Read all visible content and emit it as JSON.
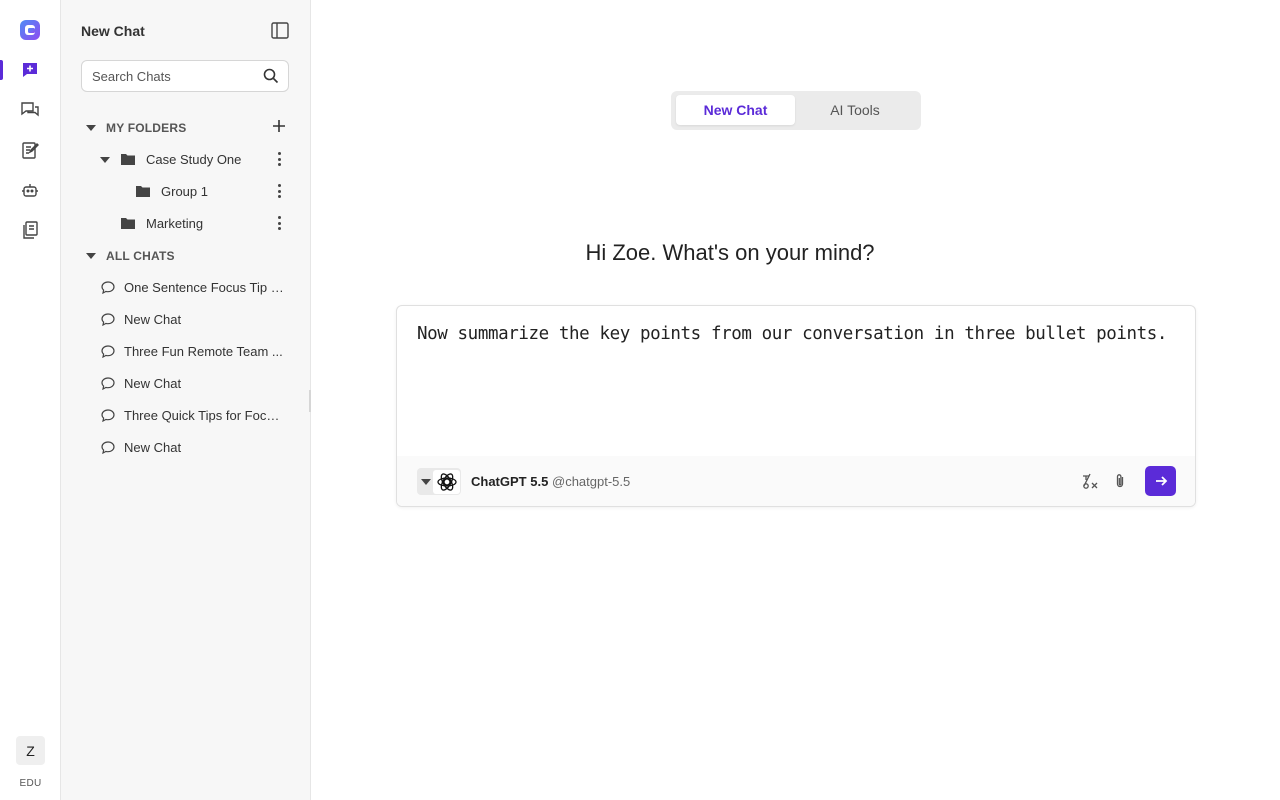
{
  "rail": {
    "avatar_initial": "Z",
    "edu_label": "EDU",
    "accent_color": "#5b2bd8"
  },
  "sidebar": {
    "title": "New Chat",
    "search": {
      "placeholder": "Search Chats"
    },
    "folders_section": {
      "label": "MY FOLDERS",
      "items": [
        {
          "name": "Case Study One"
        },
        {
          "name": "Group 1"
        },
        {
          "name": "Marketing"
        }
      ]
    },
    "chats_section": {
      "label": "ALL CHATS",
      "items": [
        {
          "name": "One Sentence Focus Tip f..."
        },
        {
          "name": "New Chat"
        },
        {
          "name": "Three Fun Remote Team ..."
        },
        {
          "name": "New Chat"
        },
        {
          "name": "Three Quick Tips for Focu..."
        },
        {
          "name": "New Chat"
        }
      ]
    }
  },
  "main": {
    "tabs": [
      {
        "label": "New Chat",
        "active": true
      },
      {
        "label": "AI Tools",
        "active": false
      }
    ],
    "greeting": "Hi Zoe. What's on your mind?",
    "composer": {
      "text": "Now summarize the key points from our conversation in three bullet points.",
      "model_name": "ChatGPT 5.5",
      "model_handle": "@chatgpt-5.5"
    }
  }
}
